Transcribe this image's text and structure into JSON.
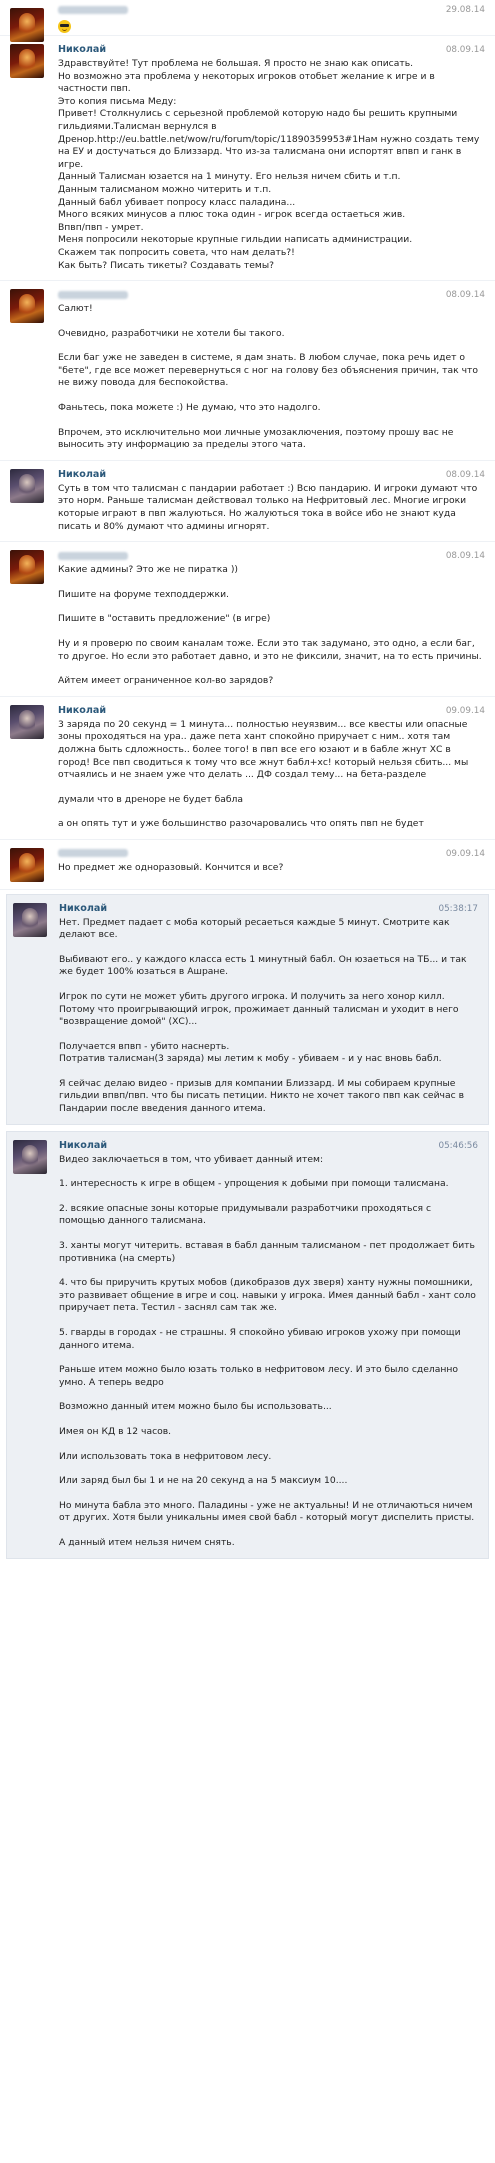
{
  "messages": [
    {
      "author": "",
      "date": "29.08.14",
      "avatar": "paladin-avatar",
      "paragraphs": [],
      "emoji": "sunglasses-emoji"
    },
    {
      "author": "Николай",
      "date": "08.09.14",
      "avatar": "paladin-avatar",
      "paragraphs": [
        "Здравствуйте! Тут проблема не большая. Я просто не знаю как описать.\nНо возможно эта проблема у некоторых игроков отобьет желание к игре и в частности пвп.\nЭто копия письма Меду:\nПривет! Столкнулись с серьезной проблемой которую надо бы решить крупными гильдиями.Талисман вернулся в Дренор.http://eu.battle.net/wow/ru/forum/topic/11890359953#1Нам нужно создать тему на ЕУ и достучаться до Близзард. Что из-за талисмана они испортят впвп и ганк в игре.\nДанный Талисман юзается на 1 минуту. Его нельзя ничем сбить и т.п.\nДанным талисманом можно читерить и т.п.\nДанный бабл убивает попросу класс паладина...\nМного всяких минусов а плюс тока один - игрок всегда остаеться жив.\nВпвп/пвп - умрет.\nМеня попросили некоторые крупные гильдии написать администрации.\nСкажем так попросить совета, что нам делать?!\nКак быть? Писать тикеты? Создавать темы?"
      ]
    },
    {
      "author": "",
      "date": "08.09.14",
      "avatar": "paladin-avatar",
      "paragraphs": [
        "Салют!",
        "Очевидно, разработчики не хотели бы такого.",
        "Если баг уже не заведен в системе, я дам знать. В любом случае, пока речь идет о \"бете\", где все может перевернуться с ног на голову без объяснения причин, так что не вижу повода для беспокойства.",
        "Фаньтесь, пока можете :) Не думаю, что это надолго.",
        "Впрочем, это исключительно мои личные умозаключения, поэтому прошу вас не выносить эту информацию за пределы этого чата."
      ]
    },
    {
      "author": "Николай",
      "date": "08.09.14",
      "avatar": "hunter-avatar",
      "paragraphs": [
        "Суть в том что талисман с пандарии работает :) Всю пандарию. И игроки думают что это норм. Раньше талисман действовал только на Нефритовый лес. Многие игроки которые играют в пвп жалуються. Но жалуються тока в войсе ибо не знают куда писать и 80% думают что админы игнорят."
      ]
    },
    {
      "author": "",
      "date": "08.09.14",
      "avatar": "paladin-avatar",
      "paragraphs": [
        "Какие админы? Это же не пиратка ))",
        "Пишите на форуме техподдержки.",
        "Пишите в \"оставить предложение\" (в игре)",
        "Ну и я проверю по своим каналам тоже. Если это так задумано, это одно, а если баг, то другое. Но если это работает давно, и это не фиксили, значит, на то есть причины.",
        "Айтем имеет ограниченное кол-во зарядов?"
      ]
    },
    {
      "author": "Николай",
      "date": "09.09.14",
      "avatar": "hunter-avatar",
      "paragraphs": [
        "3 заряда по 20 секунд = 1 минута... полностью неуязвим... все квесты или опасные зоны проходяться на ура.. даже пета хант спокойно приручает с ним.. хотя там должна быть сдложность.. более того! в пвп все его юзают и в бабле жнут ХС в город! Все пвп сводиться к тому что все жнут бабл+хс! который нельзя сбить... мы отчаялись и не знаем уже что делать ... ДФ создал тему... на бета-разделе",
        "думали что в дреноре не будет бабла",
        "а он опять тут и уже большинство разочаровались что опять пвп не будет"
      ]
    },
    {
      "author": "",
      "date": "09.09.14",
      "avatar": "paladin-avatar",
      "paragraphs": [
        "Но предмет же одноразовый. Кончится и все?"
      ]
    },
    {
      "author": "Николай",
      "date": "05:38:17",
      "avatar": "hunter-avatar",
      "highlight": true,
      "paragraphs": [
        "Нет. Предмет падает с моба который ресаеться каждые 5 минут. Смотрите как делают все.",
        "Выбивают его.. у каждого класса есть 1 минутный бабл. Он юзаеться на ТБ... и так же будет 100% юзаться в Ашране.",
        "Игрок по сути не может убить другого игрока. И получить за него хонор килл. Потому что проигрывающий игрок, прожимает данный талисман и уходит в него \"возвращение домой\" (ХС)...",
        "Получается впвп - убито наснерть.\nПотратив талисман(3 заряда) мы летим к мобу - убиваем - и у нас вновь бабл.",
        "Я сейчас делаю видео - призыв для компании Близзард. И мы собираем крупные гильдии впвп/пвп. что бы писать петиции. Никто не хочет такого пвп как сейчас в Пандарии после введения данного итема."
      ]
    },
    {
      "author": "Николай",
      "date": "05:46:56",
      "avatar": "hunter-avatar",
      "highlight": true,
      "paragraphs": [
        "Видео заключаеться в том, что убивает данный итем:",
        "1. интересность к игре в общем - упрощения к добыми при помощи талисмана.",
        "2. всякие опасные зоны которые придумывали разработчики проходяться с помощью данного талисмана.",
        "3. ханты могут читерить. вставая в бабл данным талисманом - пет продолжает бить противника (на смерть)",
        "4. что бы приручить крутых мобов (дикобразов дух зверя) ханту нужны помошники, это развивает общение в игре и соц. навыки у игрока. Имея данный бабл - хант соло приручает пета. Тестил - заснял сам так же.",
        "5. гварды в городах - не страшны. Я спокойно убиваю игроков ухожу при помощи данного итема.",
        "Раньше итем можно было юзать только в нефритовом лесу. И это было сделанно умно. А теперь ведро",
        "Возможно данный итем можно было бы использовать...",
        "Имея он КД в 12 часов.",
        "Или использовать тока в нефритовом лесу.",
        "Или заряд был бы 1 и не на 20 секунд а на 5 максиум 10....",
        "Но минута бабла это много. Паладины - уже не актуальны! И не отличаються ничем от других. Хотя были уникальны имея свой бабл - который могут диспелить присты.",
        "А данный итем нельзя ничем снять."
      ]
    }
  ]
}
